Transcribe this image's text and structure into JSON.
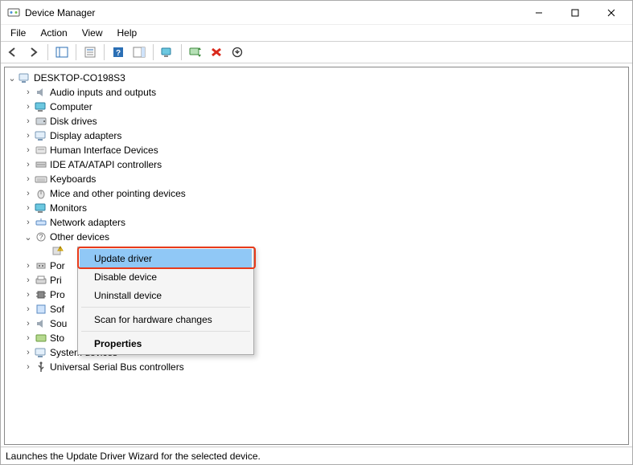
{
  "window": {
    "title": "Device Manager"
  },
  "menu": {
    "file": "File",
    "action": "Action",
    "view": "View",
    "help": "Help"
  },
  "toolbar_icons": {
    "back": "back-arrow",
    "forward": "forward-arrow",
    "show_hide": "show-hide-console-tree",
    "properties": "properties",
    "help": "help",
    "panel": "action-pane",
    "monitor": "scan-hardware-changes",
    "update": "update-driver",
    "uninstall": "uninstall-device",
    "refresh": "enable-device"
  },
  "tree": {
    "root": {
      "label": "DESKTOP-CO198S3",
      "expanded": true
    },
    "categories": [
      {
        "label": "Audio inputs and outputs",
        "icon": "audio",
        "expanded": false
      },
      {
        "label": "Computer",
        "icon": "computer",
        "expanded": false
      },
      {
        "label": "Disk drives",
        "icon": "disk",
        "expanded": false
      },
      {
        "label": "Display adapters",
        "icon": "display",
        "expanded": false
      },
      {
        "label": "Human Interface Devices",
        "icon": "hid",
        "expanded": false
      },
      {
        "label": "IDE ATA/ATAPI controllers",
        "icon": "ide",
        "expanded": false
      },
      {
        "label": "Keyboards",
        "icon": "keyboard",
        "expanded": false
      },
      {
        "label": "Mice and other pointing devices",
        "icon": "mouse",
        "expanded": false
      },
      {
        "label": "Monitors",
        "icon": "monitor",
        "expanded": false
      },
      {
        "label": "Network adapters",
        "icon": "network",
        "expanded": false
      },
      {
        "label": "Other devices",
        "icon": "other",
        "expanded": true
      }
    ],
    "other_device_child": {
      "label": "",
      "icon": "warning"
    },
    "rest": [
      {
        "label": "Por",
        "icon": "ports"
      },
      {
        "label": "Pri",
        "icon": "printqueue"
      },
      {
        "label": "Pro",
        "icon": "processor"
      },
      {
        "label": "Sof",
        "icon": "software"
      },
      {
        "label": "Sou",
        "icon": "sound"
      },
      {
        "label": "Sto",
        "icon": "storage"
      }
    ],
    "after_rest": [
      {
        "label": "System devices",
        "icon": "system"
      },
      {
        "label": "Universal Serial Bus controllers",
        "icon": "usb"
      }
    ]
  },
  "context_menu": {
    "update": "Update driver",
    "disable": "Disable device",
    "uninstall": "Uninstall device",
    "scan": "Scan for hardware changes",
    "properties": "Properties"
  },
  "statusbar": {
    "text": "Launches the Update Driver Wizard for the selected device."
  }
}
